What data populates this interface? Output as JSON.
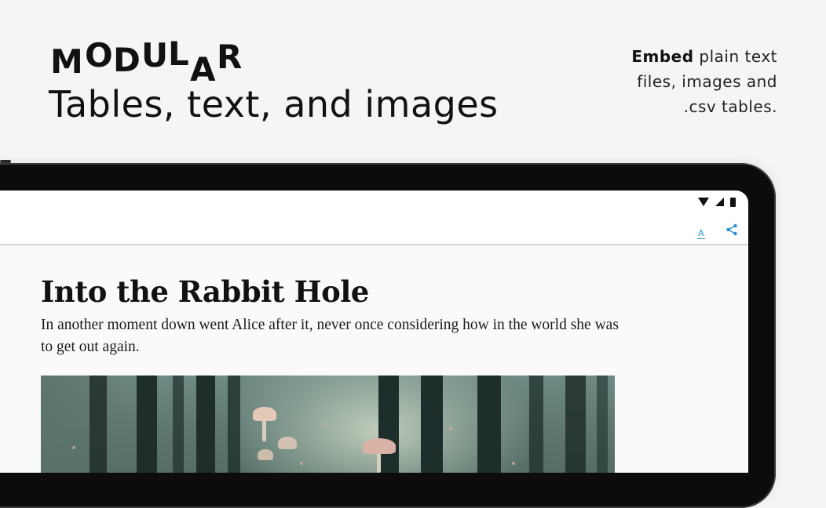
{
  "promo": {
    "logo_letters": [
      "M",
      "O",
      "D",
      "U",
      "L",
      "A",
      "R"
    ],
    "headline": "Tables, text, and images",
    "tagline_bold": "Embed",
    "tagline_line1_rest": " plain text",
    "tagline_line2": "files, images and",
    "tagline_line3": ".csv tables."
  },
  "toolbar": {
    "font_icon_label": "A",
    "font_icon": "text-format-icon",
    "share_icon": "share-icon"
  },
  "status_bar": {
    "icons": [
      "wifi-icon",
      "signal-icon",
      "battery-icon"
    ]
  },
  "document": {
    "title": "Into the Rabbit Hole",
    "paragraph": "In another moment down went Alice after it, never once considering how in the world she was to get out again.",
    "image": "forest-mushrooms-image"
  },
  "colors": {
    "accent": "#2a8fd0",
    "background": "#f5f5f5",
    "bezel": "#0c0c0c"
  }
}
